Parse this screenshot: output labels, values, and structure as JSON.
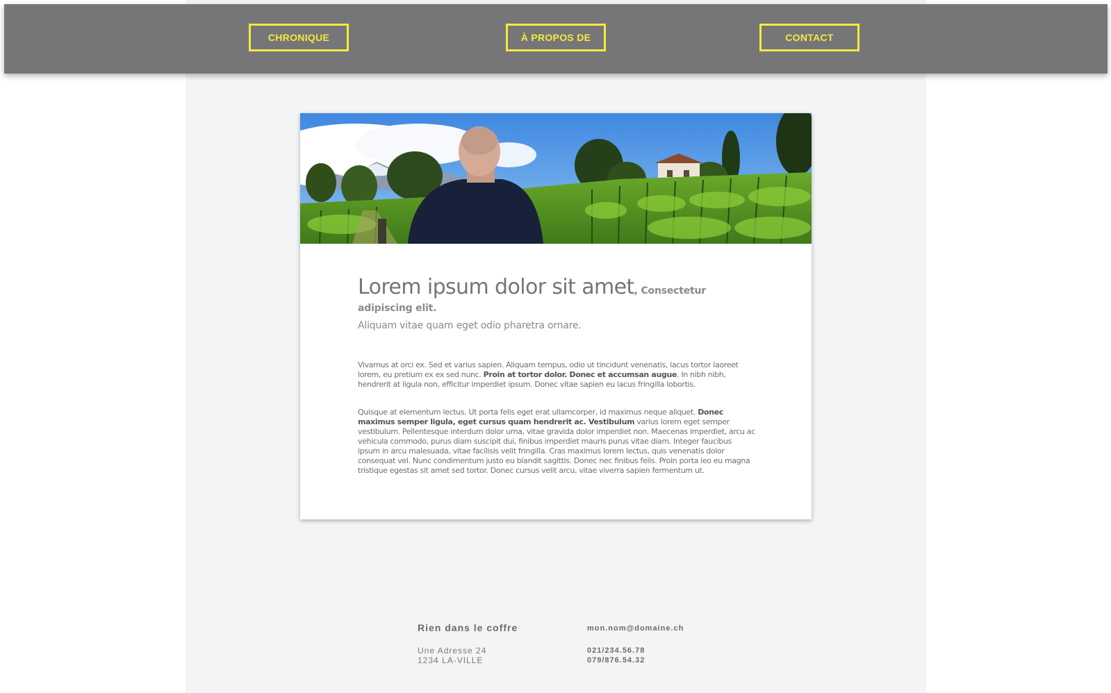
{
  "nav": {
    "items": [
      {
        "label": "CHRONIQUE"
      },
      {
        "label": "À PROPOS DE"
      },
      {
        "label": "CONTACT"
      }
    ],
    "accent_color": "#f3ea3d",
    "bar_color": "#767678"
  },
  "article": {
    "hero_image": "vineyard-photo",
    "title": "Lorem ipsum dolor sit amet",
    "title_suffix": ", Consectetur adipiscing elit.",
    "subtitle": "Aliquam vitae quam eget odio pharetra ornare.",
    "paragraph1": {
      "text_a": "Vivamus at orci ex. Sed et varius sapien. Aliquam tempus, odio ut tincidunt venenatis, lacus tortor laoreet lorem, eu pretium ex ex sed nunc. ",
      "bold": "Proin at tortor dolor. Donec et accumsan augue",
      "text_b": ". In nibh nibh, hendrerit at ligula non, efficitur imperdiet ipsum. Donec vitae sapien eu lacus fringilla lobortis."
    },
    "paragraph2": {
      "text_a": "Quisque at elementum lectus. Ut porta felis eget erat ullamcorper, id maximus neque aliquet. ",
      "bold": "Donec maximus semper ligula, eget cursus quam hendrerit ac. Vestibulum",
      "text_b": " varius lorem eget semper vestibulum. Pellentesque interdum dolor urna, vitae gravida dolor imperdiet non. Maecenas imperdiet, arcu ac vehicula commodo, purus diam suscipit dui, finibus imperdiet mauris purus vitae diam. Integer faucibus ipsum in arcu malesuada, vitae facilisis velit fringilla. Cras maximus lorem lectus, quis venenatis dolor consequat vel. Nunc condimentum justo eu blandit sagittis. Donec nec finibus felis. Proin porta leo eu magna tristique egestas sit amet sed tortor. Donec cursus velit arcu, vitae viverra sapien fermentum ut."
    }
  },
  "footer": {
    "name": "Rien dans le coffre",
    "address_line1": "Une Adresse 24",
    "address_line2": "1234 LA-VILLE",
    "email": "mon.nom@domaine.ch",
    "phone1": "021/234.56.78",
    "phone2": "079/876.54.32"
  }
}
